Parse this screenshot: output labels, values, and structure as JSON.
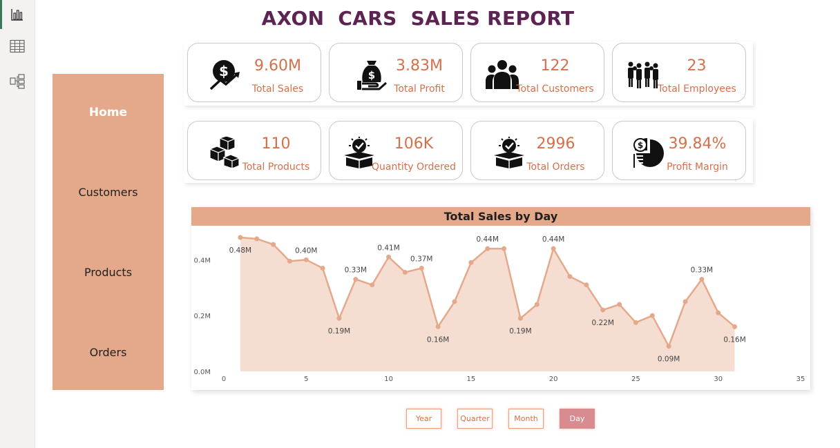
{
  "title": "AXON  CARS  SALES REPORT",
  "rail": {
    "items": [
      {
        "icon": "bar-chart-icon",
        "active": true
      },
      {
        "icon": "table-icon",
        "active": false
      },
      {
        "icon": "hierarchy-icon",
        "active": false
      }
    ]
  },
  "nav": {
    "items": [
      {
        "label": "Home",
        "active": true
      },
      {
        "label": "Customers",
        "active": false
      },
      {
        "label": "Products",
        "active": false
      },
      {
        "label": "Orders",
        "active": false
      }
    ]
  },
  "kpis": {
    "row1": [
      {
        "icon": "dollar-growth-icon",
        "value": "9.60M",
        "label": "Total Sales"
      },
      {
        "icon": "money-bag-hand-icon",
        "value": "3.83M",
        "label": "Total Profit"
      },
      {
        "icon": "customers-group-icon",
        "value": "122",
        "label": "Total Customers"
      },
      {
        "icon": "employees-group-icon",
        "value": "23",
        "label": "Total Employees"
      }
    ],
    "row2": [
      {
        "icon": "boxes-icon",
        "value": "110",
        "label": "Total Products"
      },
      {
        "icon": "box-check-icon",
        "value": "106K",
        "label": "Quantity Ordered"
      },
      {
        "icon": "box-check-icon",
        "value": "2996",
        "label": "Total Orders"
      },
      {
        "icon": "pie-dollar-icon",
        "value": "39.84%",
        "label": "Profit Margin"
      }
    ]
  },
  "chart_data": {
    "type": "area",
    "title": "Total Sales by Day",
    "xlabel": "",
    "ylabel": "",
    "xlim": [
      0,
      35
    ],
    "ylim": [
      0,
      0.48
    ],
    "x_ticks": [
      "0",
      "5",
      "10",
      "15",
      "20",
      "25",
      "30",
      "35"
    ],
    "y_ticks": [
      "0.0M",
      "0.2M",
      "0.4M"
    ],
    "grid": false,
    "x": [
      1,
      2,
      3,
      4,
      5,
      6,
      7,
      8,
      9,
      10,
      11,
      12,
      13,
      14,
      15,
      16,
      17,
      18,
      19,
      20,
      21,
      22,
      23,
      24,
      25,
      26,
      27,
      28,
      29,
      30,
      31
    ],
    "values": [
      0.48,
      0.475,
      0.455,
      0.395,
      0.4,
      0.37,
      0.19,
      0.33,
      0.31,
      0.41,
      0.355,
      0.37,
      0.16,
      0.25,
      0.39,
      0.44,
      0.44,
      0.19,
      0.24,
      0.44,
      0.34,
      0.31,
      0.22,
      0.24,
      0.175,
      0.2,
      0.09,
      0.25,
      0.33,
      0.21,
      0.16
    ],
    "data_labels": [
      {
        "x": 1,
        "text": "0.48M"
      },
      {
        "x": 5,
        "text": "0.40M"
      },
      {
        "x": 7,
        "text": "0.19M"
      },
      {
        "x": 8,
        "text": "0.33M"
      },
      {
        "x": 10,
        "text": "0.41M"
      },
      {
        "x": 12,
        "text": "0.37M"
      },
      {
        "x": 13,
        "text": "0.16M"
      },
      {
        "x": 16,
        "text": "0.44M"
      },
      {
        "x": 18,
        "text": "0.19M"
      },
      {
        "x": 20,
        "text": "0.44M"
      },
      {
        "x": 23,
        "text": "0.22M"
      },
      {
        "x": 27,
        "text": "0.09M"
      },
      {
        "x": 29,
        "text": "0.33M"
      },
      {
        "x": 31,
        "text": "0.16M"
      }
    ],
    "line_color": "#e4a98b",
    "fill_color": "#f5ddd2"
  },
  "periods": [
    {
      "label": "Year",
      "active": false
    },
    {
      "label": "Quarter",
      "active": false
    },
    {
      "label": "Month",
      "active": false
    },
    {
      "label": "Day",
      "active": true
    }
  ]
}
